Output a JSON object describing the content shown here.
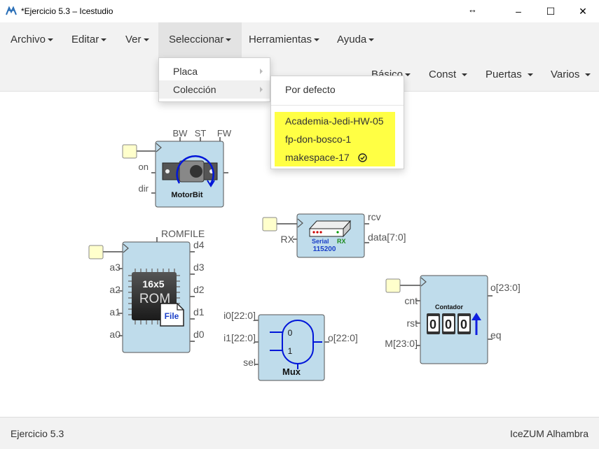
{
  "window": {
    "title": "*Ejercicio 5.3 – Icestudio",
    "resize_glyph": "↔",
    "minimize": "–",
    "maximize": "☐",
    "close": "✕"
  },
  "menubar": {
    "items": [
      {
        "label": "Archivo"
      },
      {
        "label": "Editar"
      },
      {
        "label": "Ver"
      },
      {
        "label": "Seleccionar"
      },
      {
        "label": "Herramientas"
      },
      {
        "label": "Ayuda"
      }
    ],
    "categories": [
      {
        "label": "Básico"
      },
      {
        "label": "Const"
      },
      {
        "label": "Puertas"
      },
      {
        "label": "Varios"
      }
    ]
  },
  "seleccionar_menu": {
    "items": [
      {
        "label": "Placa"
      },
      {
        "label": "Colección"
      }
    ]
  },
  "coleccion_menu": {
    "items": [
      {
        "label": "Por defecto"
      },
      {
        "label": "Academia-Jedi-HW-05"
      },
      {
        "label": "fp-don-bosco-1"
      },
      {
        "label": "makespace-17",
        "checked": true
      }
    ]
  },
  "canvas": {
    "motorbit": {
      "params": [
        "BW",
        "ST",
        "FW"
      ],
      "inputs": [
        "on",
        "dir"
      ],
      "label": "MotorBit"
    },
    "rom": {
      "param": "ROMFILE",
      "inputs": [
        "a3",
        "a2",
        "a1",
        "a0"
      ],
      "outputs": [
        "d4",
        "d3",
        "d2",
        "d1",
        "d0"
      ],
      "chip_size": "16x5",
      "chip_label": "ROM",
      "file_label": "File"
    },
    "serial": {
      "input": "RX",
      "outputs": [
        "rcv",
        "data[7:0]"
      ],
      "label_serial": "Serial",
      "label_rx": "RX",
      "baud": "115200"
    },
    "counter": {
      "inputs": [
        "cnt",
        "rst",
        "M[23:0]"
      ],
      "outputs": [
        "o[23:0]",
        "eq"
      ],
      "label": "Contador",
      "digits": [
        "0",
        "0",
        "0"
      ]
    },
    "mux": {
      "inputs": [
        "i0[22:0]",
        "i1[22:0]",
        "sel"
      ],
      "output": "o[22:0]",
      "in0": "0",
      "in1": "1",
      "label": "Mux"
    }
  },
  "statusbar": {
    "left": "Ejercicio 5.3",
    "right": "IceZUM Alhambra"
  },
  "colors": {
    "block_fill": "#bfdceb",
    "block_stroke": "#555555",
    "highlight": "#ffff44",
    "param_fill": "#ffffcc"
  }
}
